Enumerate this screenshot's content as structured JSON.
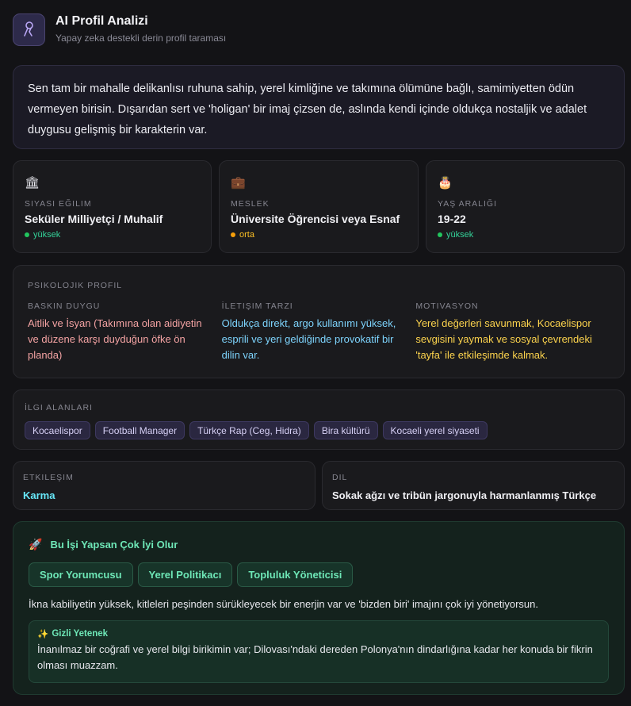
{
  "header": {
    "logo_icon": "ribbon-icon",
    "title": "AI Profil Analizi",
    "subtitle": "Yapay zeka destekli derin profil taraması"
  },
  "summary": "Sen tam bir mahalle delikanlısı ruhuna sahip, yerel kimliğine ve takımına ölümüne bağlı, samimiyetten ödün vermeyen birisin. Dışarıdan sert ve 'holigan' bir imaj çizsen de, aslında kendi içinde oldukça nostaljik ve adalet duygusu gelişmiş bir karakterin var.",
  "stats": [
    {
      "icon": "🏛",
      "icon_name": "bank-icon",
      "label": "Siyasi Eğilim",
      "value": "Seküler Milliyetçi / Muhalif",
      "confidence": "yüksek"
    },
    {
      "icon": "💼",
      "icon_name": "briefcase-icon",
      "label": "Meslek",
      "value": "Üniversite Öğrencisi veya Esnaf",
      "confidence": "orta"
    },
    {
      "icon": "🎂",
      "icon_name": "cake-icon",
      "label": "Yaş Aralığı",
      "value": "19-22",
      "confidence": "yüksek"
    }
  ],
  "psych": {
    "title": "Psikolojik Profil",
    "columns": [
      {
        "label": "Baskın Duygu",
        "text": "Aitlik ve İsyan (Takımına olan aidiyetin ve düzene karşı duyduğun öfke ön planda)",
        "color": "#f4a3a3"
      },
      {
        "label": "İletişim Tarzı",
        "text": "Oldukça direkt, argo kullanımı yüksek, esprili ve yeri geldiğinde provokatif bir dilin var.",
        "color": "#7dd3fc"
      },
      {
        "label": "Motivasyon",
        "text": "Yerel değerleri savunmak, Kocaelispor sevgisini yaymak ve sosyal çevrendeki 'tayfa' ile etkileşimde kalmak.",
        "color": "#fcd34d"
      }
    ]
  },
  "interests": {
    "title": "İlgi Alanları",
    "tags": [
      "Kocaelispor",
      "Football Manager",
      "Türkçe Rap (Ceg, Hidra)",
      "Bira kültürü",
      "Kocaeli yerel siyaseti"
    ]
  },
  "engagement": {
    "label": "Etkileşim",
    "value": "Karma",
    "color": "#67e8f9"
  },
  "language": {
    "label": "Dil",
    "value": "Sokak ağzı ve tribün jargonuyla harmanlanmış Türkçe"
  },
  "career": {
    "icon": "🚀",
    "title": "Bu İşi Yapsan Çok İyi Olur",
    "jobs": [
      "Spor Yorumcusu",
      "Yerel Politikacı",
      "Topluluk Yöneticisi"
    ],
    "description": "İkna kabiliyetin yüksek, kitleleri peşinden sürükleyecek bir enerjin var ve 'bizden biri' imajını çok iyi yönetiyorsun.",
    "hidden_talent": {
      "icon": "✨",
      "title": "Gizli Yetenek",
      "text": "İnanılmaz bir coğrafi ve yerel bilgi birikimin var; Dilovası'ndaki dereden Polonya'nın dindarlığına kadar her konuda bir fikrin olması muazzam."
    }
  }
}
